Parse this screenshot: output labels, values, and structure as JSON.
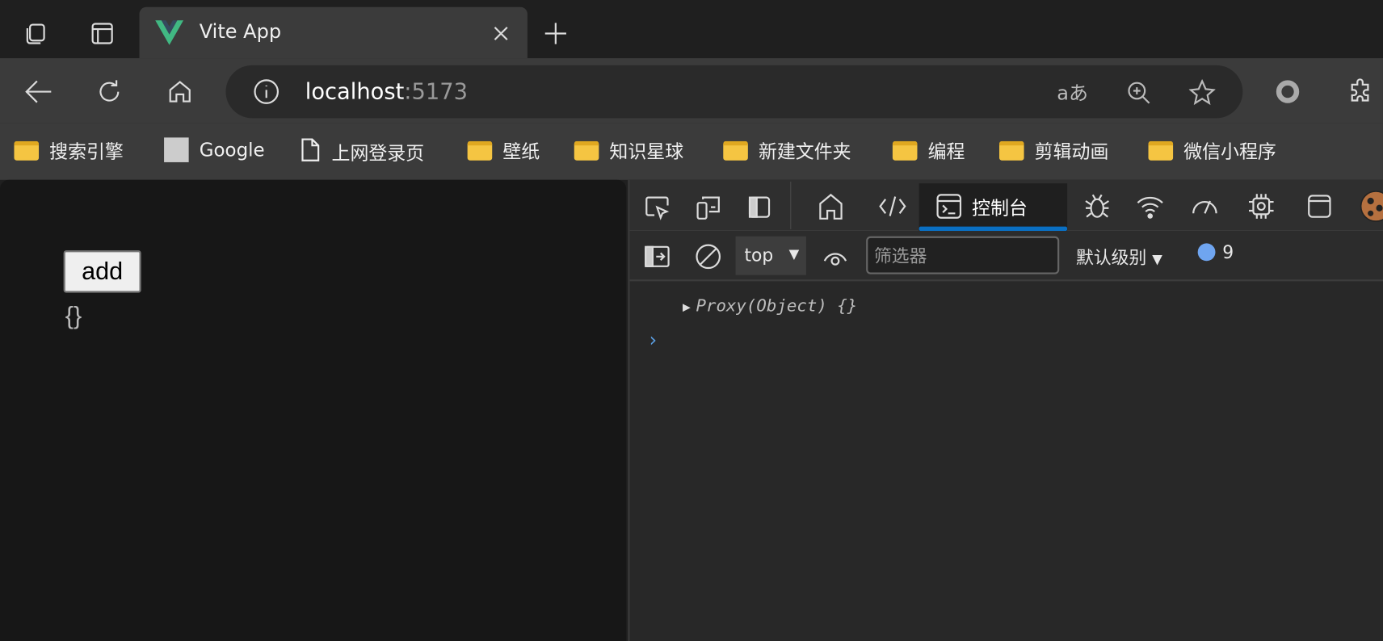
{
  "tab": {
    "title": "Vite App"
  },
  "address": {
    "host": "localhost",
    "port": ":5173"
  },
  "bookmarks": [
    {
      "label": "搜索引擎",
      "icon": "folder-icon"
    },
    {
      "label": "Google",
      "icon": "favicon"
    },
    {
      "label": "上网登录页",
      "icon": "page-icon"
    },
    {
      "label": "壁纸",
      "icon": "folder-icon"
    },
    {
      "label": "知识星球",
      "icon": "folder-icon"
    },
    {
      "label": "新建文件夹",
      "icon": "folder-icon"
    },
    {
      "label": "编程",
      "icon": "folder-icon"
    },
    {
      "label": "剪辑动画",
      "icon": "folder-icon"
    },
    {
      "label": "微信小程序",
      "icon": "folder-icon"
    }
  ],
  "page": {
    "button_label": "add",
    "output": "{}"
  },
  "devtools": {
    "console_tab": "控制台",
    "context": "top",
    "filter_placeholder": "筛选器",
    "level": "默认级别",
    "message_count": "9",
    "log_entry": "Proxy(Object) {}",
    "accent": "#0a6fc2"
  }
}
